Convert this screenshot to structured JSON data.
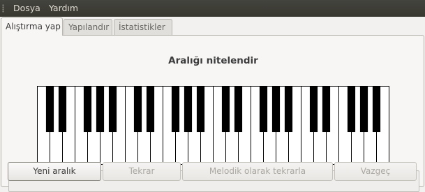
{
  "menubar": {
    "items": [
      "Dosya",
      "Yardım"
    ]
  },
  "tabs": [
    {
      "label": "Alıştırma yap",
      "active": true
    },
    {
      "label": "Yapılandır",
      "active": false
    },
    {
      "label": "İstatistikler",
      "active": false
    }
  ],
  "exercise": {
    "title": "Aralığı nitelendir",
    "answer_text": ""
  },
  "piano": {
    "octaves": 4,
    "white_keys": 28,
    "black_keys": 20
  },
  "buttons": {
    "new_interval": "Yeni aralık",
    "repeat": "Tekrar",
    "repeat_melodic": "Melodik olarak tekrarla",
    "give_up": "Vazgeç"
  },
  "colors": {
    "menubar_bg": "#3c3b37",
    "menubar_text": "#dfdbd2",
    "window_bg": "#f2f1f0",
    "black_key": "#000000",
    "white_key": "#ffffff"
  }
}
